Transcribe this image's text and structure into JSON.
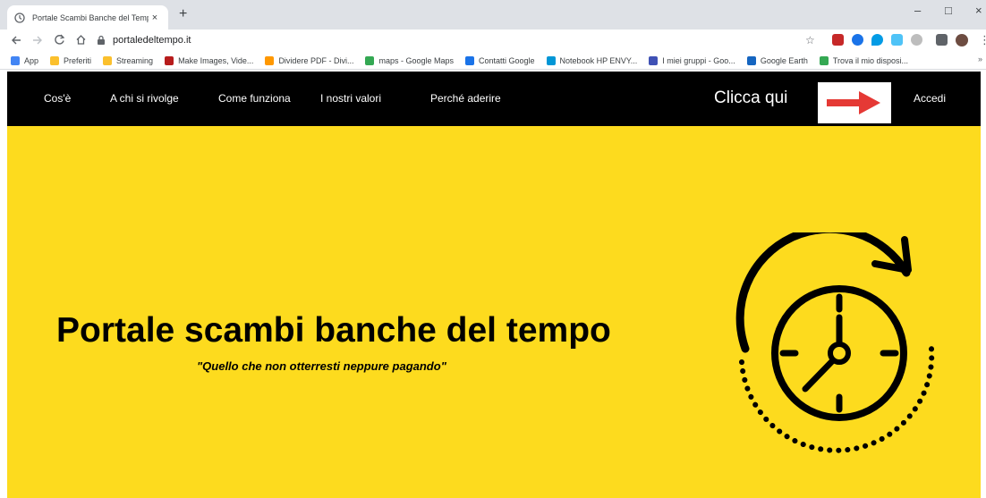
{
  "browser": {
    "tab_title": "Portale Scambi Banche del Tempo",
    "tab_close": "×",
    "new_tab": "+",
    "url": "portaledeltempo.it",
    "controls": {
      "minimize": "–",
      "maximize": "□",
      "close": "×"
    }
  },
  "bookmarks": [
    {
      "label": "App",
      "color": "#4285f4"
    },
    {
      "label": "Preferiti",
      "color": "#fbc02d"
    },
    {
      "label": "Streaming",
      "color": "#fbc02d"
    },
    {
      "label": "Make Images, Vide...",
      "color": "#b71c1c"
    },
    {
      "label": "Dividere PDF - Divi...",
      "color": "#ff9800"
    },
    {
      "label": "maps - Google Maps",
      "color": "#34a853"
    },
    {
      "label": "Contatti Google",
      "color": "#1a73e8"
    },
    {
      "label": "Notebook HP ENVY...",
      "color": "#0096d6"
    },
    {
      "label": "I miei gruppi - Goo...",
      "color": "#3f51b5"
    },
    {
      "label": "Google Earth",
      "color": "#1565c0"
    },
    {
      "label": "Trova il mio disposi...",
      "color": "#34a853"
    }
  ],
  "bookmarks_more": "»",
  "site_nav": {
    "links": [
      "Cos'è",
      "A chi si rivolge",
      "Come funziona",
      "I nostri valori",
      "Perché aderire"
    ],
    "cta_text": "Clicca qui",
    "login": "Accedi"
  },
  "hero": {
    "title": "Portale scambi banche del tempo",
    "subtitle": "\"Quello che non otterresti neppure pagando\""
  },
  "colors": {
    "hero_bg": "#fddb1e",
    "nav_bg": "#000000",
    "arrow": "#e53935"
  }
}
